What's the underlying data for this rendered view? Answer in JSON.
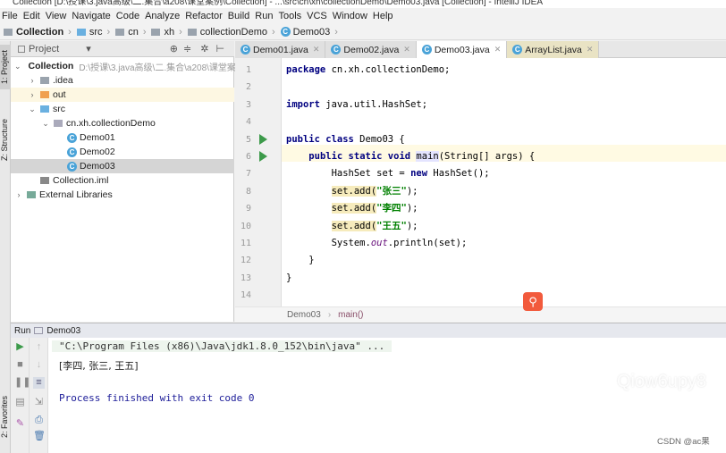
{
  "window": {
    "title": "Collection [D:\\授课\\3.java高级\\二.集合\\a208\\课堂案例\\Collection] - ...\\src\\cn\\xh\\collectionDemo\\Demo03.java [Collection] - IntelliJ IDEA"
  },
  "menu": [
    "File",
    "Edit",
    "View",
    "Navigate",
    "Code",
    "Analyze",
    "Refactor",
    "Build",
    "Run",
    "Tools",
    "VCS",
    "Window",
    "Help"
  ],
  "nav": [
    "Collection",
    "src",
    "cn",
    "xh",
    "collectionDemo",
    "Demo03"
  ],
  "side": {
    "project": "1: Project",
    "structure": "Z: Structure",
    "favorites": "2: Favorites"
  },
  "project_panel": {
    "title": "Project",
    "dropdown": "▾"
  },
  "tree": [
    {
      "label": "Collection",
      "path": "D:\\授课\\3.java高级\\二.集合\\a208\\课堂案例"
    },
    {
      "label": ".idea"
    },
    {
      "label": "out"
    },
    {
      "label": "src"
    },
    {
      "label": "cn.xh.collectionDemo"
    },
    {
      "label": "Demo01"
    },
    {
      "label": "Demo02"
    },
    {
      "label": "Demo03"
    },
    {
      "label": "Collection.iml"
    },
    {
      "label": "External Libraries"
    }
  ],
  "tabs": [
    "Demo01.java",
    "Demo02.java",
    "Demo03.java",
    "ArrayList.java"
  ],
  "active_tab": "Demo03.java",
  "code": [
    [
      [
        "package",
        "kw"
      ],
      [
        " cn.xh.collectionDemo;",
        ""
      ]
    ],
    [],
    [
      [
        "import",
        "kw"
      ],
      [
        " java.util.HashSet;",
        ""
      ]
    ],
    [],
    [
      [
        "public class",
        "kw"
      ],
      [
        " Demo03 {",
        ""
      ]
    ],
    [
      [
        "    ",
        ""
      ],
      [
        "public static void",
        "kw"
      ],
      [
        " ",
        ""
      ],
      [
        "main",
        "meth"
      ],
      [
        "(String[] args) {",
        ""
      ]
    ],
    [
      [
        "        HashSet set = ",
        ""
      ],
      [
        "new",
        "kw"
      ],
      [
        " HashSet();",
        ""
      ]
    ],
    [
      [
        "        ",
        ""
      ],
      [
        "set.add(",
        "warn"
      ],
      [
        "\"张三\"",
        "str"
      ],
      [
        ");",
        ""
      ]
    ],
    [
      [
        "        ",
        ""
      ],
      [
        "set.add(",
        "warn"
      ],
      [
        "\"李四\"",
        "str"
      ],
      [
        ");",
        ""
      ]
    ],
    [
      [
        "        ",
        ""
      ],
      [
        "set.add(",
        "warn"
      ],
      [
        "\"王五\"",
        "str"
      ],
      [
        ");",
        ""
      ]
    ],
    [
      [
        "        System.",
        ""
      ],
      [
        "out",
        "fld"
      ],
      [
        ".println(set);",
        ""
      ]
    ],
    [
      [
        "    }",
        ""
      ]
    ],
    [
      [
        "}",
        ""
      ]
    ],
    []
  ],
  "editor_breadcrumb": [
    "Demo03",
    "main()"
  ],
  "run": {
    "label": "Run",
    "config": "Demo03",
    "output": [
      "\"C:\\Program Files (x86)\\Java\\jdk1.8.0_152\\bin\\java\" ...",
      "[李四, 张三, 王五]",
      "",
      "Process finished with exit code 0"
    ]
  },
  "overlay": {
    "watermark": "Qiow6upy8",
    "credit": "CSDN @ac果"
  },
  "colors": {
    "keyword": "#000080",
    "string": "#008000",
    "run_green": "#3c9a4a",
    "search_button": "#f25a3c"
  }
}
